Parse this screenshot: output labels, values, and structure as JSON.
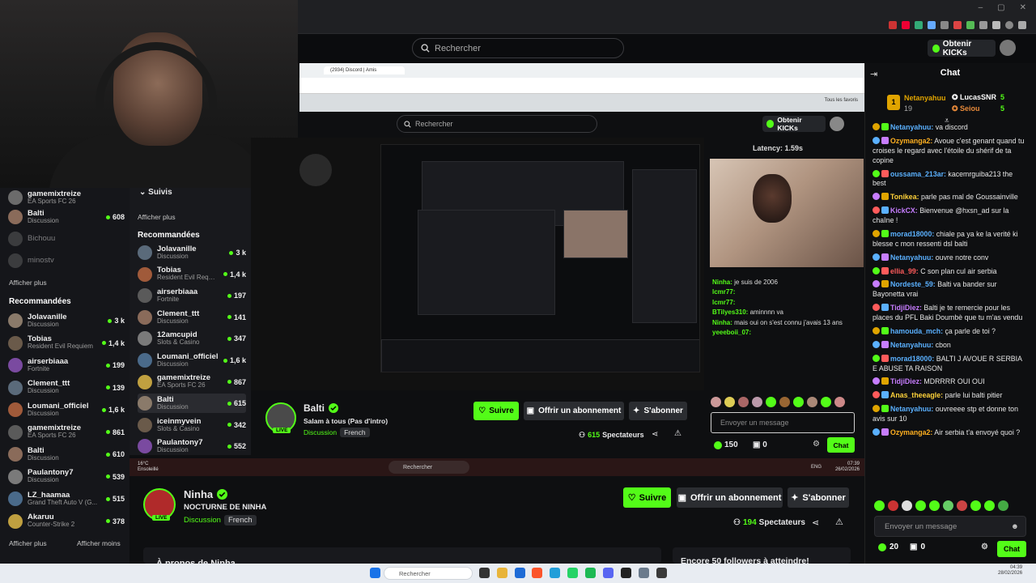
{
  "top": {
    "search_placeholder": "Rechercher",
    "kicks_label": "Obtenir KICKs"
  },
  "sidebar": {
    "followed": [
      {
        "name": "Balti",
        "category": "Discussion",
        "viewers": "608"
      },
      {
        "name": "Bichouu",
        "category": ""
      },
      {
        "name": "minostv",
        "category": ""
      }
    ],
    "partial_top": {
      "name": "gamemixtreize",
      "category": "EA Sports FC 26"
    },
    "show_more": "Afficher plus",
    "recommended_title": "Recommandées",
    "recommended": [
      {
        "name": "Jolavanille",
        "category": "Discussion",
        "viewers": "3 k"
      },
      {
        "name": "Tobias",
        "category": "Resident Evil Requiem",
        "viewers": "1,4 k"
      },
      {
        "name": "airserbiaaa",
        "category": "Fortnite",
        "viewers": "199"
      },
      {
        "name": "Clement_ttt",
        "category": "Discussion",
        "viewers": "139"
      },
      {
        "name": "Loumani_officiel",
        "category": "Discussion",
        "viewers": "1,6 k"
      },
      {
        "name": "gamemixtreize",
        "category": "EA Sports FC 26",
        "viewers": "861"
      },
      {
        "name": "Balti",
        "category": "Discussion",
        "viewers": "610"
      },
      {
        "name": "Paulantony7",
        "category": "Discussion",
        "viewers": "539"
      },
      {
        "name": "LZ_haamaa",
        "category": "Grand Theft Auto V (G...",
        "viewers": "515"
      },
      {
        "name": "Akaruu",
        "category": "Counter-Strike 2",
        "viewers": "378"
      }
    ],
    "show_less": "Afficher moins"
  },
  "inner_sidebar": {
    "followed_label": "Suivis",
    "show_more": "Afficher plus",
    "recommended_title": "Recommandées",
    "items": [
      {
        "name": "Jolavanille",
        "category": "Discussion",
        "viewers": "3 k"
      },
      {
        "name": "Tobias",
        "category": "Resident Evil Requiem",
        "viewers": "1,4 k"
      },
      {
        "name": "airserbiaaa",
        "category": "Fortnite",
        "viewers": "197"
      },
      {
        "name": "Clement_ttt",
        "category": "Discussion",
        "viewers": "141"
      },
      {
        "name": "12amcupid",
        "category": "Slots & Casino",
        "viewers": "347"
      },
      {
        "name": "Loumani_officiel",
        "category": "Discussion",
        "viewers": "1,6 k"
      },
      {
        "name": "gamemixtreize",
        "category": "EA Sports FC 26",
        "viewers": "867"
      },
      {
        "name": "Balti",
        "category": "Discussion",
        "viewers": "615"
      },
      {
        "name": "iceinmyvein",
        "category": "Slots & Casino",
        "viewers": "342"
      },
      {
        "name": "Paulantony7",
        "category": "Discussion",
        "viewers": "552"
      }
    ]
  },
  "nested": {
    "discord_tab": "(2934) Discord | Amis",
    "search_placeholder": "Rechercher",
    "kicks_label": "Obtenir KICKs",
    "latency": "Latency: 1.59s",
    "bookmarks": "Tous les favoris",
    "chat_lines": [
      {
        "user": "Ninha:",
        "text": "je suis de 2006"
      },
      {
        "user": "lcmr77:",
        "text": ""
      },
      {
        "user": "lcmr77:",
        "text": ""
      },
      {
        "user": "BTilyes310:",
        "text": "aminnnn va"
      },
      {
        "user": "Ninha:",
        "text": "mais oui on s'est connu j'avais 13 ans"
      },
      {
        "user": "yeeeboii_07:",
        "text": ""
      }
    ],
    "chat_input_placeholder": "Envoyer un message",
    "kicks_count": "150",
    "zero_count": "0",
    "chat_button": "Chat"
  },
  "balti": {
    "name": "Balti",
    "title": "Salam à tous (Pas d'intro)",
    "category": "Discussion",
    "tag": "French",
    "live": "LIVE",
    "follow": "Suivre",
    "gift_sub": "Offrir un abonnement",
    "subscribe": "S'abonner",
    "viewers": "615",
    "viewers_label": "Spectateurs"
  },
  "nested_taskbar": {
    "weather": "16°C",
    "weather_desc": "Ensoleillé",
    "search": "Rechercher",
    "time": "07:39",
    "date": "26/02/2026",
    "lang": "ENG"
  },
  "ninha": {
    "name": "Ninha",
    "title": "NOCTURNE DE NINHA",
    "category": "Discussion",
    "tag": "French",
    "live": "LIVE",
    "follow": "Suivre",
    "gift_sub": "Offrir un abonnement",
    "subscribe": "S'abonner",
    "viewers": "194",
    "viewers_label": "Spectateurs",
    "about": "À propos de Ninha",
    "followers_goal": "Encore 50 followers à atteindre!"
  },
  "chat": {
    "title": "Chat",
    "leaders": [
      {
        "rank": "1",
        "name": "Netanyahuu",
        "count": "19"
      },
      {
        "name": "LucasSNR",
        "count": "5"
      },
      {
        "name": "Seiou",
        "count": "5"
      }
    ],
    "messages": [
      {
        "user": "Netanyahuu:",
        "text": "va discord",
        "color": "#5ab0ff"
      },
      {
        "user": "Ozymanga2:",
        "text": "Avoue c'est genant quand tu croises le regard avec l'étoile du shérif de ta copine",
        "color": "#ffb020"
      },
      {
        "user": "oussama_213ar:",
        "text": "kacemrguiba213 the best",
        "color": "#5ab0ff"
      },
      {
        "user": "Tonikea:",
        "text": "parle pas mal de Goussainville",
        "color": "#ffd23a"
      },
      {
        "user": "KickCX:",
        "text": "Bienvenue @hxsn_ad sur la chaîne !",
        "color": "#c77dff"
      },
      {
        "user": "morad18000:",
        "text": "chiale pa ya ke la verité ki blesse c mon ressenti dsl balti",
        "color": "#5ab0ff"
      },
      {
        "user": "Netanyahuu:",
        "text": "ouvre notre conv",
        "color": "#5ab0ff"
      },
      {
        "user": "ellia_99:",
        "text": "C son plan cul air serbia",
        "color": "#ff5b5b"
      },
      {
        "user": "Nordeste_59:",
        "text": "Balti va bander sur Bayonetta vrai",
        "color": "#5ab0ff"
      },
      {
        "user": "TidjiDiez:",
        "text": "Balti je te remercie pour les places du PFL Baki Doumbè que tu m'as vendu",
        "color": "#c77dff"
      },
      {
        "user": "hamouda_mch:",
        "text": "ça parle de toi ?",
        "color": "#5ab0ff"
      },
      {
        "user": "Netanyahuu:",
        "text": "cbon",
        "color": "#5ab0ff"
      },
      {
        "user": "morad18000:",
        "text": "BALTI J AVOUE R SERBIA E ABUSE TA RAISON",
        "color": "#5ab0ff"
      },
      {
        "user": "TidjiDiez:",
        "text": "MDRRRR OUI OUI",
        "color": "#c77dff"
      },
      {
        "user": "Anas_theeagle:",
        "text": "parle lui balti pitier",
        "color": "#ffd23a"
      },
      {
        "user": "Netanyahuu:",
        "text": "ouvreeee stp et donne ton avis sur 10",
        "color": "#5ab0ff"
      },
      {
        "user": "Ozymanga2:",
        "text": "Air serbia t'a envoyé quoi ?",
        "color": "#ffb020"
      }
    ],
    "input_placeholder": "Envoyer un message",
    "kicks_count": "20",
    "zero_count": "0",
    "chat_button": "Chat"
  },
  "taskbar": {
    "search": "Rechercher",
    "time": "04:39",
    "date": "28/02/2026"
  }
}
